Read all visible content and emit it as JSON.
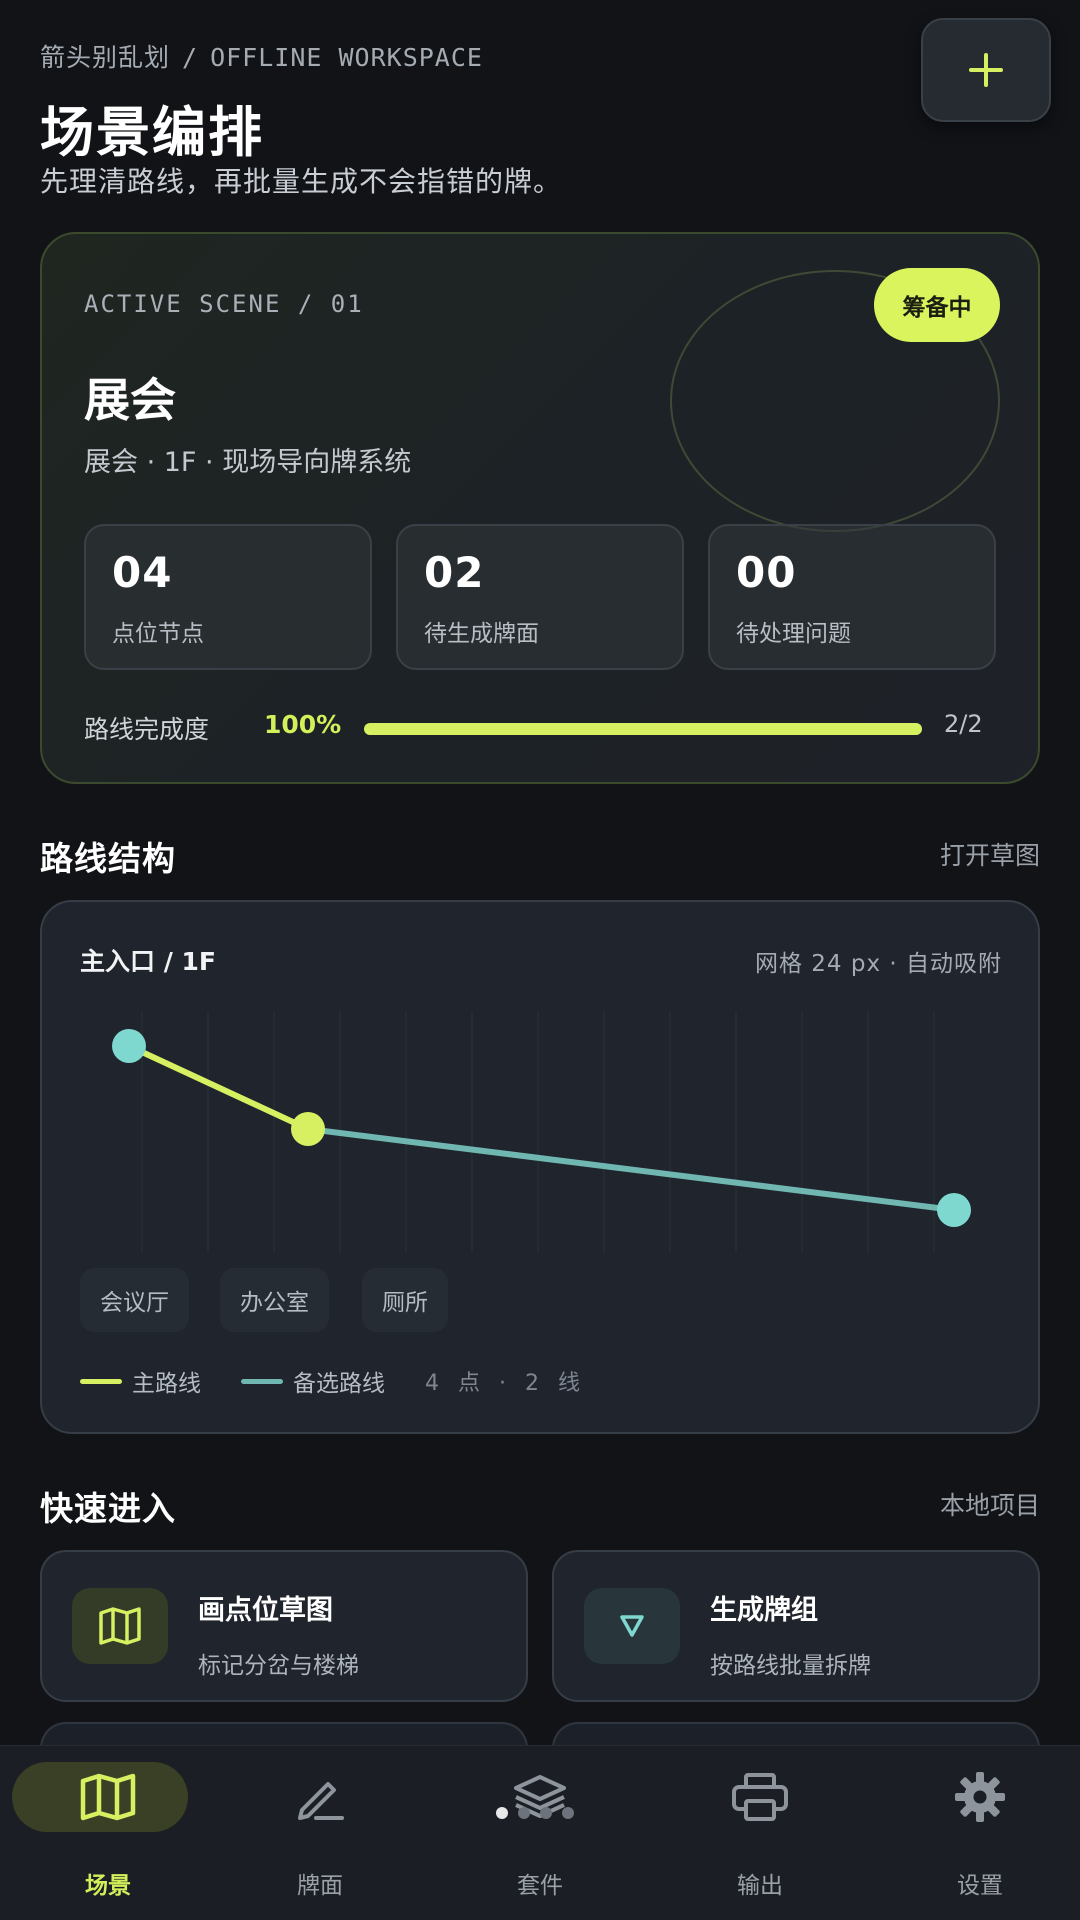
{
  "header": {
    "app_name": "箭头别乱划",
    "separator": "/",
    "workspace": "OFFLINE WORKSPACE",
    "title": "场景编排",
    "subtitle": "先理清路线，再批量生成不会指错的牌。",
    "add_button_icon": "plus-icon"
  },
  "active_scene": {
    "eyebrow": "ACTIVE SCENE / 01",
    "status": "筹备中",
    "name": "展会",
    "meta": "展会 · 1F · 现场导向牌系统",
    "stats": [
      {
        "value": "04",
        "label": "点位节点"
      },
      {
        "value": "02",
        "label": "待生成牌面"
      },
      {
        "value": "00",
        "label": "待处理问题"
      }
    ],
    "progress": {
      "label": "路线完成度",
      "percent_text": "100%",
      "fraction": 1.0,
      "count": "2/2"
    }
  },
  "route_section": {
    "title": "路线结构",
    "link": "打开草图"
  },
  "route_card": {
    "title": "主入口 / 1F",
    "meta": "网格  24 px  ·  自动吸附",
    "chips": [
      "会议厅",
      "办公室",
      "厕所"
    ],
    "legend": [
      {
        "label": "主路线",
        "color": "#d6f062"
      },
      {
        "label": "备选路线",
        "color": "#6fb7b0"
      }
    ],
    "count": "4 点 · 2 线",
    "colors": {
      "primary": "#d6f062",
      "alternate": "#6fb7b0",
      "node_end": "#7fd8cf",
      "node_mid": "#d6f062"
    }
  },
  "quick_section": {
    "title": "快速进入",
    "link": "本地项目"
  },
  "tiles": [
    {
      "title": "画点位草图",
      "subtitle": "标记分岔与楼梯",
      "icon": "map-icon"
    },
    {
      "title": "生成牌组",
      "subtitle": "按路线批量拆牌",
      "icon": "sign-icon"
    }
  ],
  "nav": [
    {
      "label": "场景",
      "icon": "map-icon",
      "active": true
    },
    {
      "label": "牌面",
      "icon": "pen-icon",
      "active": false
    },
    {
      "label": "套件",
      "icon": "layers-icon",
      "active": false
    },
    {
      "label": "输出",
      "icon": "printer-icon",
      "active": false
    },
    {
      "label": "设置",
      "icon": "gear-icon",
      "active": false
    }
  ],
  "theme": {
    "accent": "#d6f062",
    "background": "#111317",
    "card": "#1f242d"
  }
}
